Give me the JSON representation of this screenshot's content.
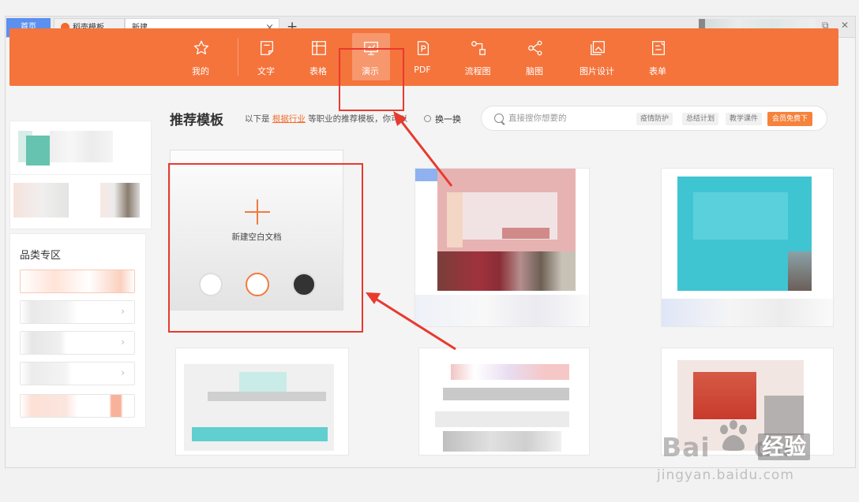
{
  "tabs": {
    "home": "首页",
    "docer": "稻壳模板",
    "new": "新建",
    "close_glyph": "×",
    "add_glyph": "+"
  },
  "window": {
    "restore_glyph": "⧉",
    "close_glyph": "✕"
  },
  "toolbar": {
    "items": [
      {
        "label": "我的",
        "icon": "star-icon"
      },
      {
        "label": "文字",
        "icon": "doc-text-icon"
      },
      {
        "label": "表格",
        "icon": "table-icon"
      },
      {
        "label": "演示",
        "icon": "presentation-icon",
        "active": true
      },
      {
        "label": "PDF",
        "icon": "pdf-icon"
      },
      {
        "label": "流程图",
        "icon": "flowchart-icon"
      },
      {
        "label": "脑图",
        "icon": "mindmap-icon"
      },
      {
        "label": "图片设计",
        "icon": "image-design-icon"
      },
      {
        "label": "表单",
        "icon": "form-icon"
      }
    ],
    "color": "#f4743c"
  },
  "sidebar": {
    "category_title": "品类专区",
    "chevron": "›"
  },
  "main": {
    "section_title": "推荐模板",
    "subtitle_prefix": "以下是",
    "subtitle_link": "根据行业",
    "subtitle_suffix": "等职业的推荐模板，你可以",
    "swap_label": "换一换"
  },
  "search": {
    "placeholder": "直接搜你想要的",
    "tags": [
      "疫情防护",
      "总结计划",
      "教学课件"
    ],
    "vip_label": "会员免费下"
  },
  "blank_doc": {
    "label": "新建空白文档",
    "swatches": [
      "#ffffff",
      "#ffffff",
      "#333333"
    ],
    "accent": "#f27a3e"
  },
  "annotation_color": "#e83a2e",
  "watermark": {
    "brand": "Bai",
    "brand2": "du",
    "cn": "经验",
    "url": "jingyan.baidu.com"
  }
}
